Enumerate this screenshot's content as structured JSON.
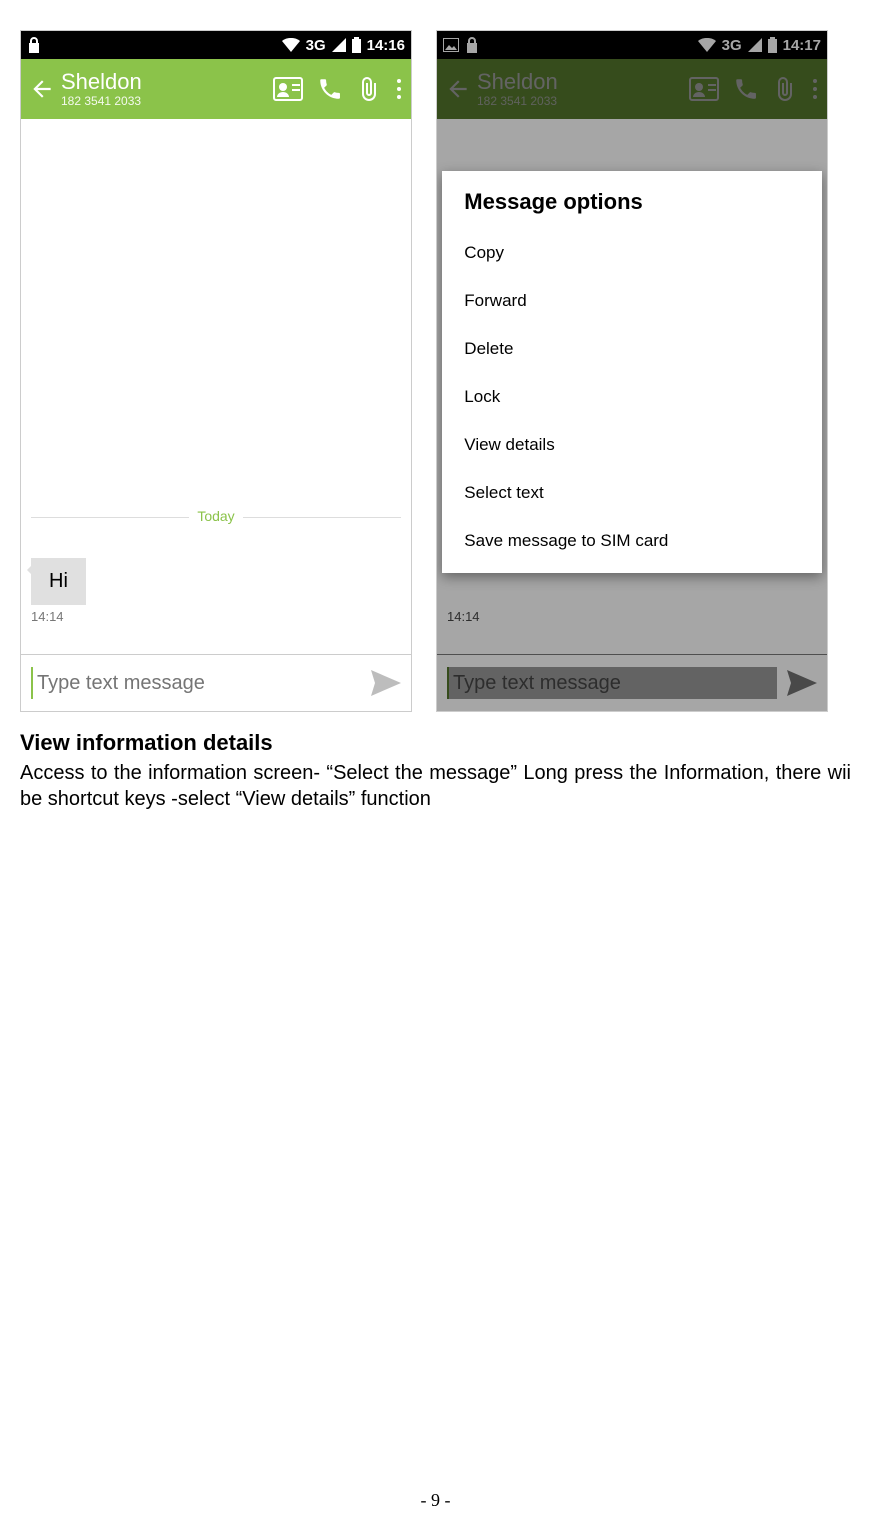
{
  "status": {
    "network": "3G",
    "time_left": "14:16",
    "time_right": "14:17"
  },
  "contact": {
    "name": "Sheldon",
    "number": "182 3541 2033"
  },
  "conversation": {
    "divider": "Today",
    "message_text": "Hi",
    "message_time": "14:14",
    "input_placeholder": "Type text message"
  },
  "dialog": {
    "title": "Message options",
    "items": [
      "Copy",
      "Forward",
      "Delete",
      "Lock",
      "View details",
      "Select text",
      "Save message to SIM card"
    ]
  },
  "doc": {
    "heading": "View information details",
    "paragraph": "Access to the information screen- “Select the message” Long press the Information, there wii be shortcut keys -select “View details” function"
  },
  "page_number": "- 9 -"
}
